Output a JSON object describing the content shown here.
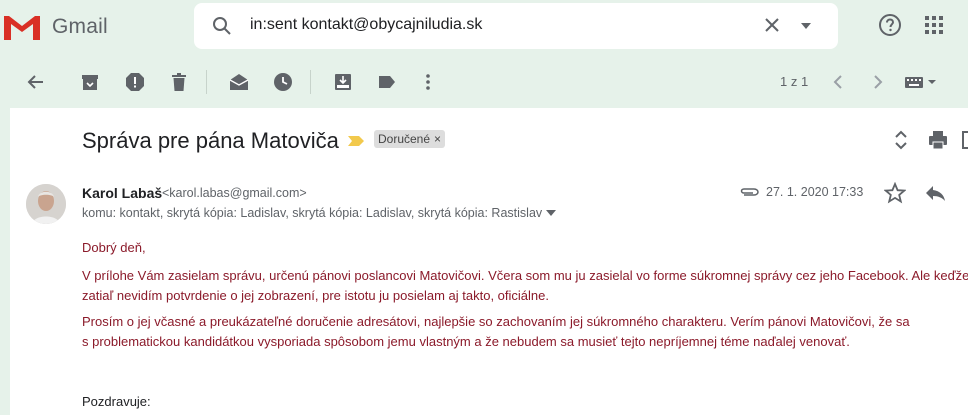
{
  "app": {
    "name": "Gmail"
  },
  "search": {
    "query": "in:sent kontakt@obycajniludia.sk"
  },
  "toolbar": {
    "pager": "1 z 1"
  },
  "message": {
    "subject": "Správa pre pána Matoviča",
    "label": "Doručené",
    "sender_name": "Karol Labaš",
    "sender_email": "<karol.labas@gmail.com>",
    "recipients": "komu: kontakt, skrytá kópia: Ladislav, skrytá kópia: Ladislav, skrytá kópia: Rastislav",
    "date": "27. 1. 2020 17:33",
    "greeting": "Dobrý deň,",
    "paragraph1_line1": "V prílohe Vám zasielam správu, určenú pánovi poslancovi Matovičovi. Včera som mu ju zasielal vo forme súkromnej správy cez jeho Facebook. Ale keďže",
    "paragraph1_line2": "zatiaľ nevidím potvrdenie o jej zobrazení, pre istotu ju posielam aj takto, oficiálne.",
    "paragraph2_line1": "Prosím o jej včasné a preukázateľné doručenie adresátovi, najlepšie so zachovaním jej súkromného charakteru. Verím pánovi Matovičovi, že sa",
    "paragraph2_line2": "s problematickou kandidátkou vysporiada spôsobom jemu vlastným a že nebudem sa musieť tejto nepríjemnej téme naďalej venovať.",
    "closing": "Pozdravuje:"
  },
  "colors": {
    "background": "#e6f2ea",
    "body_text": "#8b1a2a",
    "important_marker": "#f2c94c"
  }
}
